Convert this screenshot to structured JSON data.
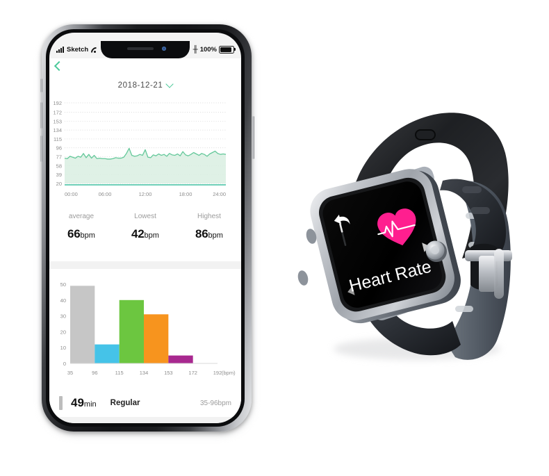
{
  "phone": {
    "status_bar": {
      "carrier": "Sketch",
      "signal_icon": "signal-bars-icon",
      "wifi_icon": "wifi-icon",
      "bluetooth_icon": "bluetooth-icon",
      "battery_percent": "100%",
      "battery_icon": "battery-full-icon"
    },
    "nav": {
      "back_icon": "chevron-left-icon"
    },
    "date_selector": {
      "value": "2018-12-21",
      "chevron_icon": "chevron-down-icon"
    },
    "stats": [
      {
        "label": "average",
        "value": "66",
        "unit": "bpm"
      },
      {
        "label": "Lowest",
        "value": "42",
        "unit": "bpm"
      },
      {
        "label": "Highest",
        "value": "86",
        "unit": "bpm"
      }
    ],
    "zone_legend": {
      "duration_value": "49",
      "duration_unit": "min",
      "zone_name": "Regular",
      "range": "35-96bpm",
      "color": "#bdbdbd"
    }
  },
  "chart_data": [
    {
      "type": "area",
      "title": "Heart rate over time",
      "xlabel": "",
      "ylabel": "bpm",
      "x_ticks": [
        "00:00",
        "06:00",
        "12:00",
        "18:00",
        "24:00"
      ],
      "y_ticks": [
        192,
        172,
        153,
        134,
        115,
        96,
        77,
        58,
        39,
        20
      ],
      "ylim": [
        20,
        192
      ],
      "grid": true,
      "line_color": "#64c89a",
      "fill_color": "#d9efe2",
      "baseline_color": "#3fc0a0",
      "x": [
        0.0,
        0.4,
        0.8,
        1.2,
        1.6,
        2.0,
        2.4,
        2.8,
        3.2,
        3.6,
        4.0,
        4.4,
        4.8,
        5.2,
        5.6,
        6.0,
        6.4,
        6.8,
        7.2,
        7.6,
        8.0,
        8.4,
        8.8,
        9.2,
        9.6,
        10.0,
        10.4,
        10.8,
        11.2,
        11.6,
        12.0,
        12.4,
        12.8,
        13.2,
        13.6,
        14.0,
        14.4,
        14.8,
        15.2,
        15.6,
        16.0,
        16.4,
        16.8,
        17.2,
        17.6,
        18.0,
        18.4,
        18.8,
        19.2,
        19.6,
        20.0,
        20.4,
        20.8,
        21.2,
        21.6,
        22.0,
        22.4,
        22.8,
        23.2,
        23.6,
        24.0
      ],
      "y": [
        74,
        73,
        78,
        76,
        74,
        78,
        76,
        84,
        75,
        82,
        74,
        80,
        73,
        74,
        73,
        73,
        72,
        72,
        73,
        75,
        74,
        74,
        76,
        84,
        95,
        80,
        78,
        79,
        82,
        80,
        92,
        76,
        75,
        81,
        79,
        83,
        80,
        82,
        78,
        84,
        81,
        80,
        83,
        79,
        88,
        81,
        79,
        82,
        86,
        83,
        80,
        84,
        82,
        78,
        83,
        86,
        89,
        84,
        82,
        83,
        82
      ]
    },
    {
      "type": "bar",
      "title": "Heart rate zone distribution",
      "xlabel": "(bpm)",
      "ylabel": "",
      "x_tick_labels": [
        "35",
        "96",
        "115",
        "134",
        "153",
        "172",
        "192"
      ],
      "x_unit_label": "(bpm)",
      "y_ticks": [
        0,
        10,
        20,
        30,
        40,
        50
      ],
      "ylim": [
        0,
        50
      ],
      "categories": [
        "35-96",
        "96-115",
        "115-134",
        "134-153",
        "153-172",
        "172-192"
      ],
      "values": [
        49,
        12,
        40,
        31,
        5,
        0
      ],
      "colors": [
        "#c6c6c6",
        "#3ec1e8",
        "#6cc githubby"
      ]
    }
  ],
  "bar_colors": [
    "#c6c6c6",
    "#45c3e8",
    "#6cc640",
    "#f7941e",
    "#a8288f",
    "#ffffff"
  ],
  "watch": {
    "screen": {
      "title": "Heart Rate",
      "heart_icon": "heart-rate-icon",
      "back_arrow_icon": "back-arrow-icon",
      "scrollbar_icon": "scrollbar-indicator",
      "right_arrow_icon": "arrow-right-icon",
      "left_arrow_icon": "arrow-left-icon",
      "heart_color": "#ff1f8f",
      "background": "#000000"
    },
    "crown_icon": "crown-button-icon",
    "buckle_icon": "band-buckle-icon"
  }
}
